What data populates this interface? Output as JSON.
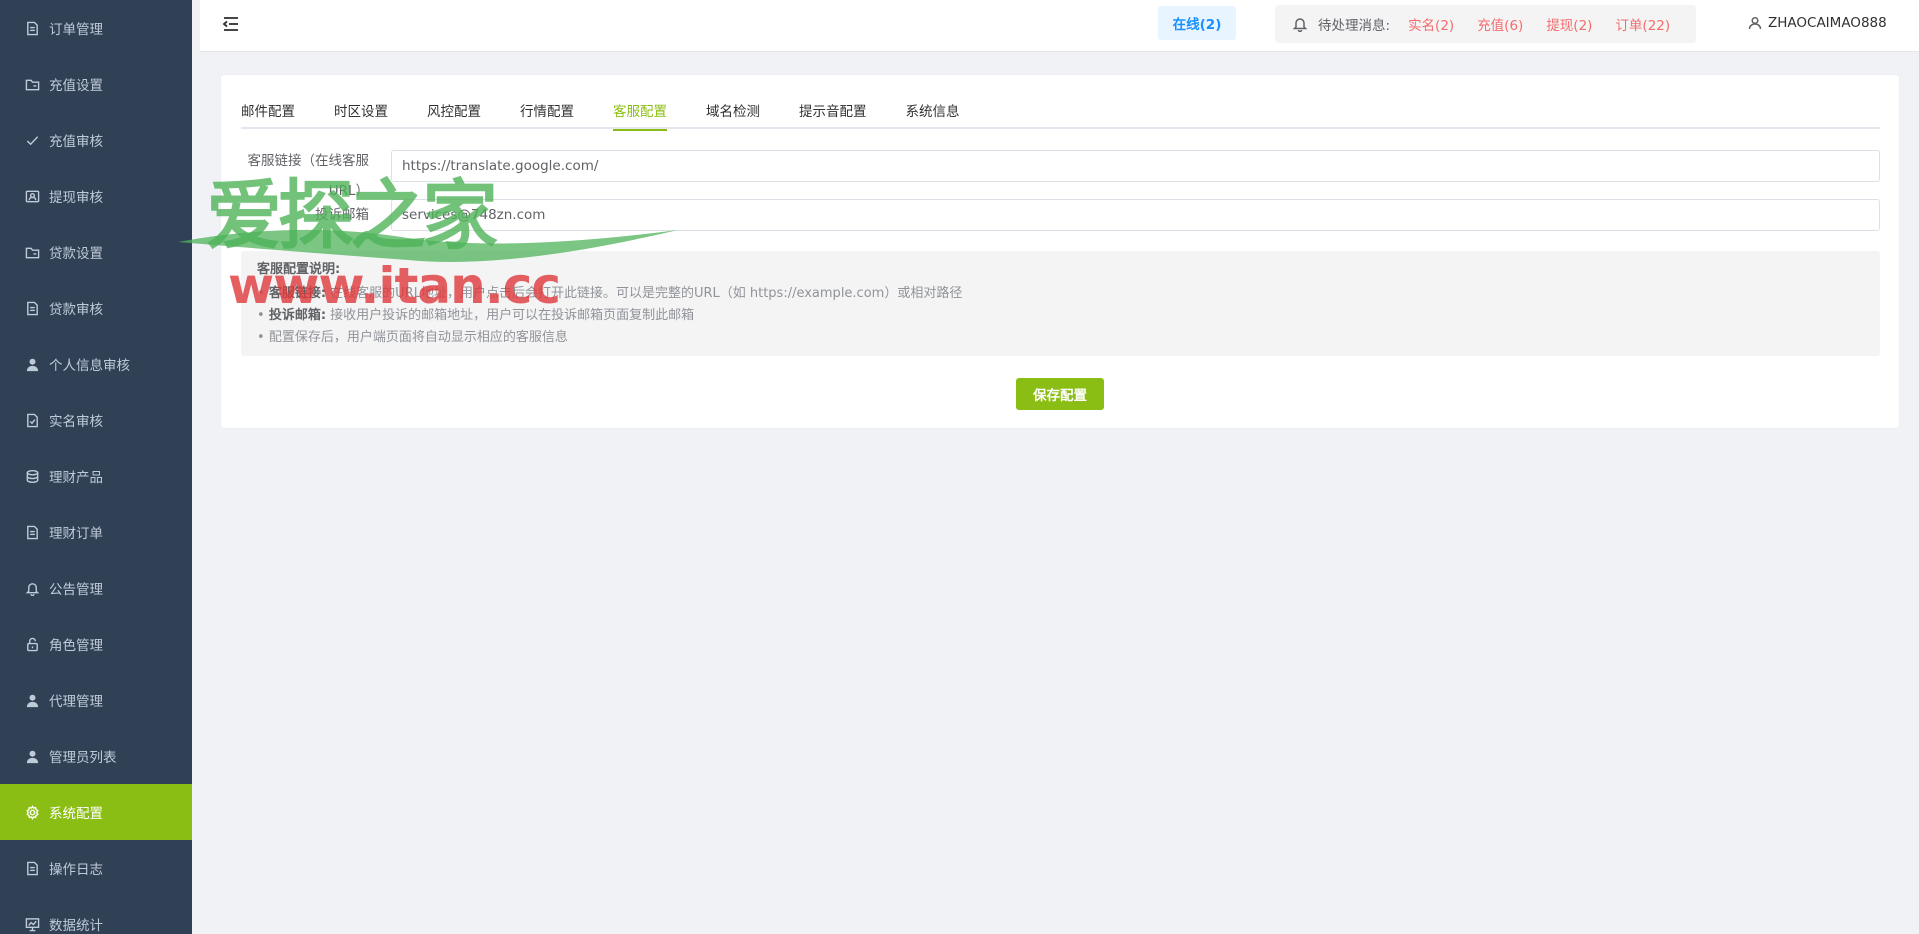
{
  "sidebar": {
    "items": [
      {
        "label": "订单管理",
        "icon": "document-icon",
        "name": "sidebar-item-orders"
      },
      {
        "label": "充值设置",
        "icon": "folder-icon",
        "name": "sidebar-item-recharge-settings"
      },
      {
        "label": "充值审核",
        "icon": "check-icon",
        "name": "sidebar-item-recharge-review"
      },
      {
        "label": "提现审核",
        "icon": "id-card-icon",
        "name": "sidebar-item-withdraw-review"
      },
      {
        "label": "贷款设置",
        "icon": "folder-icon",
        "name": "sidebar-item-loan-settings"
      },
      {
        "label": "贷款审核",
        "icon": "document-icon",
        "name": "sidebar-item-loan-review"
      },
      {
        "label": "个人信息审核",
        "icon": "user-icon",
        "name": "sidebar-item-profile-review"
      },
      {
        "label": "实名审核",
        "icon": "document-check-icon",
        "name": "sidebar-item-realname-review"
      },
      {
        "label": "理财产品",
        "icon": "coins-icon",
        "name": "sidebar-item-finance-products"
      },
      {
        "label": "理财订单",
        "icon": "document-icon",
        "name": "sidebar-item-finance-orders"
      },
      {
        "label": "公告管理",
        "icon": "bell-icon",
        "name": "sidebar-item-announcements"
      },
      {
        "label": "角色管理",
        "icon": "lock-icon",
        "name": "sidebar-item-roles"
      },
      {
        "label": "代理管理",
        "icon": "user-icon",
        "name": "sidebar-item-agents"
      },
      {
        "label": "管理员列表",
        "icon": "user-icon",
        "name": "sidebar-item-admins"
      },
      {
        "label": "系统配置",
        "icon": "gear-icon",
        "name": "sidebar-item-system-config",
        "active": true
      },
      {
        "label": "操作日志",
        "icon": "document-icon",
        "name": "sidebar-item-operation-log"
      },
      {
        "label": "数据统计",
        "icon": "chart-icon",
        "name": "sidebar-item-statistics"
      }
    ]
  },
  "header": {
    "online": "在线(2)",
    "pending_label": "待处理消息:",
    "pending": {
      "realname": "实名(2)",
      "recharge": "充值(6)",
      "withdraw": "提现(2)",
      "orders": "订单(22)"
    },
    "username": "ZHAOCAIMAO888"
  },
  "tabs": [
    "邮件配置",
    "时区设置",
    "风控配置",
    "行情配置",
    "客服配置",
    "域名检测",
    "提示音配置",
    "系统信息"
  ],
  "active_tab_index": 4,
  "form": {
    "service_link_label": "客服链接（在线客服URL）",
    "service_link_value": "https://translate.google.com/",
    "complaint_email_label": "投诉邮箱",
    "complaint_email_value": "services@748zn.com"
  },
  "info": {
    "title": "客服配置说明:",
    "line1_key": "客服链接:",
    "line1_text": "在线客服的URL地址，用户点击后会打开此链接。可以是完整的URL（如 https://example.com）或相对路径",
    "line2_key": "投诉邮箱:",
    "line2_text": "接收用户投诉的邮箱地址，用户可以在投诉邮箱页面复制此邮箱",
    "line3_text": "配置保存后，用户端页面将自动显示相应的客服信息"
  },
  "save_button": "保存配置",
  "watermark": {
    "text_top": "爱探之家",
    "text_bottom": "www.itan.cc"
  },
  "colors": {
    "sidebar_bg": "#304156",
    "accent": "#8bbe14",
    "online_blue": "#1890ff",
    "pending_red": "#f56c6c",
    "watermark_green": "#4fb35a",
    "watermark_red": "#e0393b"
  }
}
